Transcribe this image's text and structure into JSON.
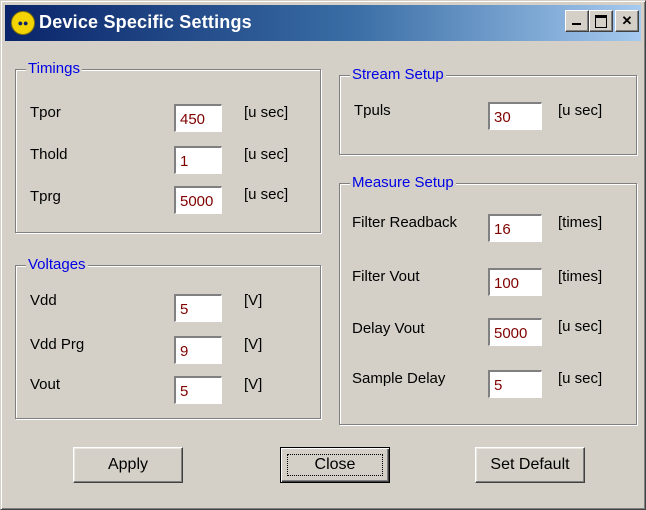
{
  "window": {
    "title": "Device Specific Settings"
  },
  "timings": {
    "title": "Timings",
    "rows": [
      {
        "label": "Tpor",
        "value": "450",
        "unit": "[u sec]"
      },
      {
        "label": "Thold",
        "value": "1",
        "unit": "[u sec]"
      },
      {
        "label": "Tprg",
        "value": "5000",
        "unit": "[u sec]"
      }
    ]
  },
  "voltages": {
    "title": "Voltages",
    "rows": [
      {
        "label": "Vdd",
        "value": "5",
        "unit": "[V]"
      },
      {
        "label": "Vdd Prg",
        "value": "9",
        "unit": "[V]"
      },
      {
        "label": "Vout",
        "value": "5",
        "unit": "[V]"
      }
    ]
  },
  "stream": {
    "title": "Stream Setup",
    "rows": [
      {
        "label": "Tpuls",
        "value": "30",
        "unit": "[u sec]"
      }
    ]
  },
  "measure": {
    "title": "Measure Setup",
    "rows": [
      {
        "label": "Filter Readback",
        "value": "16",
        "unit": "[times]"
      },
      {
        "label": "Filter Vout",
        "value": "100",
        "unit": "[times]"
      },
      {
        "label": "Delay Vout",
        "value": "5000",
        "unit": "[u sec]"
      },
      {
        "label": "Sample Delay",
        "value": "5",
        "unit": "[u sec]"
      }
    ]
  },
  "buttons": {
    "apply": "Apply",
    "close": "Close",
    "set_default": "Set Default"
  },
  "titlebar_buttons": {
    "close_glyph": "✕"
  },
  "colors": {
    "accent_text": "#0000e6",
    "value_text": "#800000",
    "face": "#d4d0c8",
    "title_start": "#0a246a",
    "title_end": "#a6caf0"
  }
}
